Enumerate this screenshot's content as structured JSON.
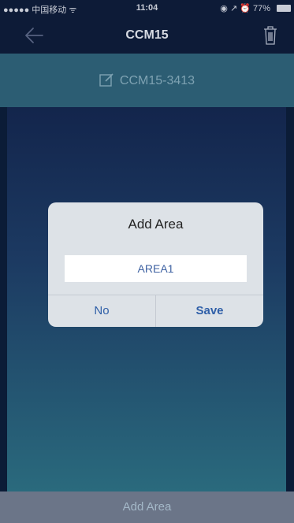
{
  "status_bar": {
    "signal": "●●●●● 中国移动 ᯤ",
    "time": "11:04",
    "right": "◉ ↗ ⏰ 77%"
  },
  "nav": {
    "title": "CCM15",
    "back_icon": "arrow-left-icon",
    "trash_icon": "trash-icon"
  },
  "subheader": {
    "icon": "edit-icon",
    "label": "CCM15-3413"
  },
  "dialog": {
    "title": "Add Area",
    "input_value": "AREA1",
    "no_label": "No",
    "save_label": "Save"
  },
  "bottom_bar": {
    "label": "Add Area"
  },
  "colors": {
    "accent": "#2f5fa8",
    "nav_bg": "#0d1b37",
    "subheader_bg": "#2c5d73"
  }
}
